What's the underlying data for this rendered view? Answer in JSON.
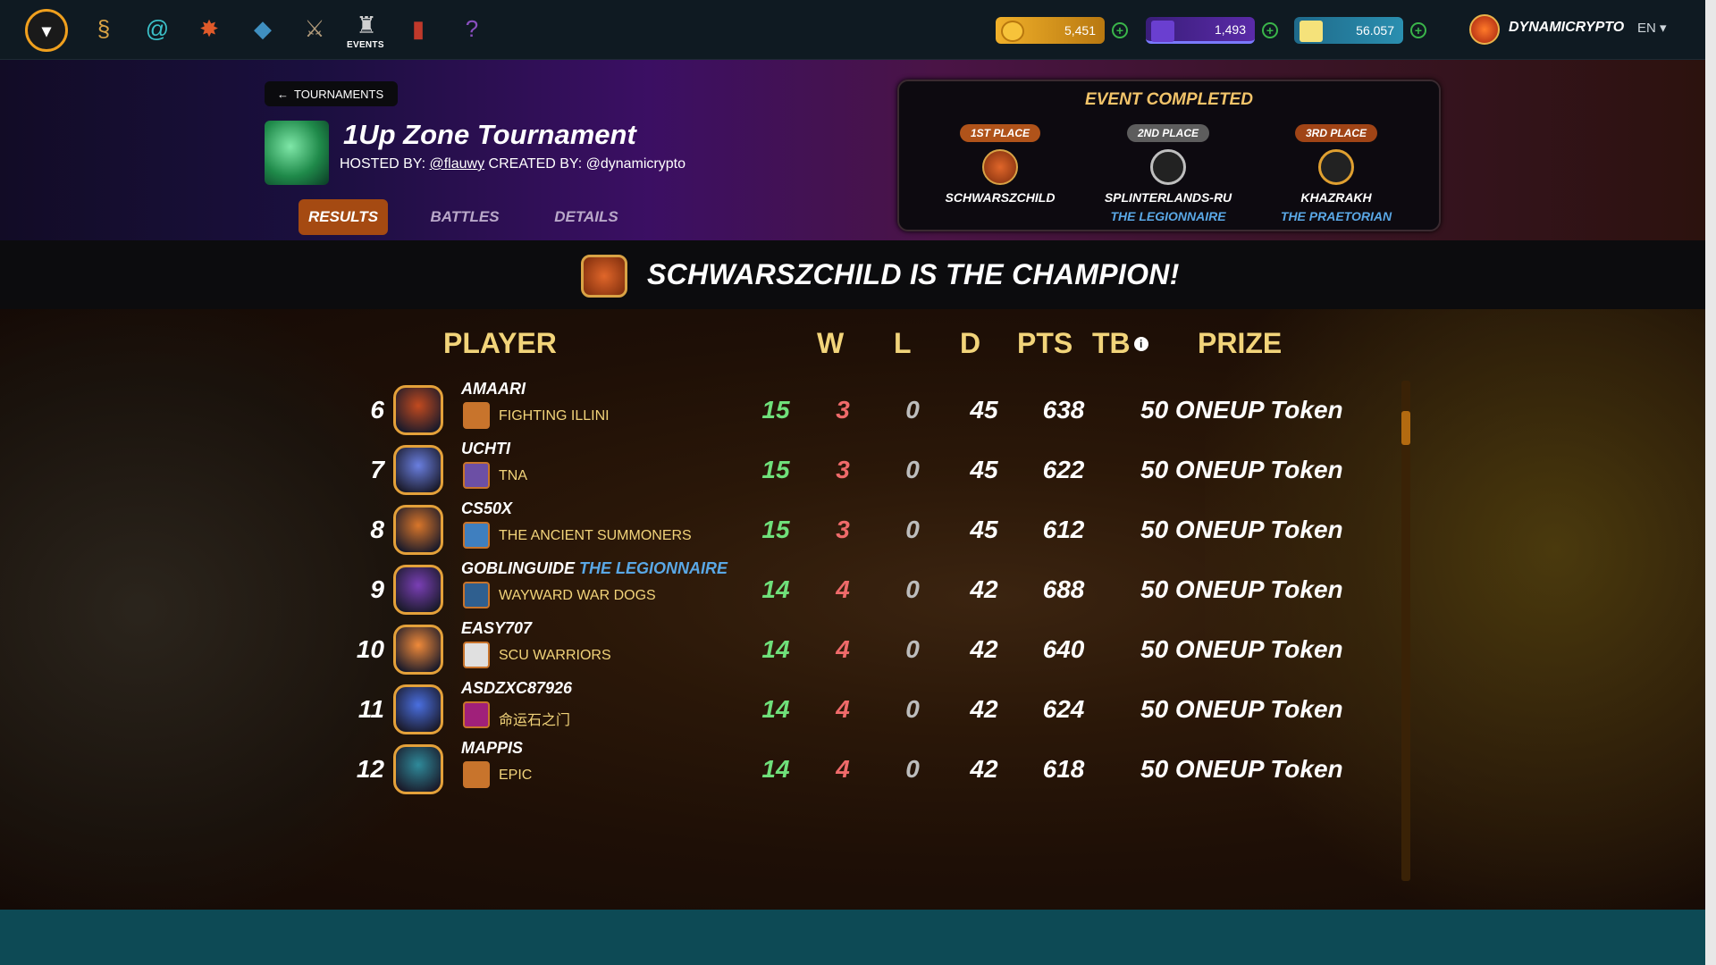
{
  "nav": {
    "icons": [
      "monster-logo-icon",
      "scroll-icon",
      "swirl-icon",
      "splinter-icon",
      "cards-icon",
      "sword-icon",
      "events-icon",
      "banner-icon",
      "quest-icon"
    ],
    "events_label": "EVENTS",
    "resources": [
      {
        "name": "credits",
        "value": "5,451",
        "color": "#e8a321"
      },
      {
        "name": "rank",
        "value": "1,493",
        "color": "#4b2a94"
      },
      {
        "name": "sps",
        "value": "56.057",
        "color": "#2a7fa0"
      }
    ],
    "username": "DYNAMICRYPTO",
    "language": "EN ▾"
  },
  "header": {
    "back_label": "TOURNAMENTS",
    "title": "1Up Zone Tournament",
    "hosted_prefix": "HOSTED BY:",
    "hosted_by": "@flauwy",
    "created_prefix": "CREATED BY:",
    "created_by": "@dynamicrypto",
    "tabs": {
      "results": "RESULTS",
      "battles": "BATTLES",
      "details": "DETAILS"
    }
  },
  "event": {
    "title": "EVENT COMPLETED",
    "places": [
      {
        "label": "1ST PLACE",
        "name": "SCHWARSZCHILD",
        "guild": "",
        "pill_color": "#b0531a"
      },
      {
        "label": "2ND PLACE",
        "name": "SPLINTERLANDS-RU",
        "guild": "THE LEGIONNAIRE",
        "pill_color": "#5d5d5d"
      },
      {
        "label": "3RD PLACE",
        "name": "KHAZRAKH",
        "guild": "THE PRAETORIAN",
        "pill_color": "#a04416"
      }
    ]
  },
  "champion": {
    "text": "SCHWARSZCHILD IS THE CHAMPION!"
  },
  "table": {
    "headers": {
      "player": "PLAYER",
      "w": "W",
      "l": "L",
      "d": "D",
      "pts": "PTS",
      "tb": "TB",
      "prize": "PRIZE"
    },
    "rows": [
      {
        "rank": "6",
        "name": "AMAARI",
        "name_guild": "",
        "guild": "FIGHTING ILLINI",
        "w": "15",
        "l": "3",
        "d": "0",
        "pts": "45",
        "tb": "638",
        "prize": "50 ONEUP Token",
        "avatar": "#c24a1f",
        "guild_color": "#c8742c"
      },
      {
        "rank": "7",
        "name": "UCHTI",
        "name_guild": "",
        "guild": "TNA",
        "w": "15",
        "l": "3",
        "d": "0",
        "pts": "45",
        "tb": "622",
        "prize": "50 ONEUP Token",
        "avatar": "#6a7fe0",
        "guild_color": "#6c4fa5"
      },
      {
        "rank": "8",
        "name": "CS50X",
        "name_guild": "",
        "guild": "THE ANCIENT SUMMONERS",
        "w": "15",
        "l": "3",
        "d": "0",
        "pts": "45",
        "tb": "612",
        "prize": "50 ONEUP Token",
        "avatar": "#d9762a",
        "guild_color": "#3f7fbf"
      },
      {
        "rank": "9",
        "name": "GOBLINGUIDE",
        "name_guild": "THE LEGIONNAIRE",
        "guild": "WAYWARD WAR DOGS",
        "w": "14",
        "l": "4",
        "d": "0",
        "pts": "42",
        "tb": "688",
        "prize": "50 ONEUP Token",
        "avatar": "#7a3fb5",
        "guild_color": "#2f5f8f"
      },
      {
        "rank": "10",
        "name": "EASY707",
        "name_guild": "",
        "guild": "SCU WARRIORS",
        "w": "14",
        "l": "4",
        "d": "0",
        "pts": "42",
        "tb": "640",
        "prize": "50 ONEUP Token",
        "avatar": "#f08a3a",
        "guild_color": "#e0e0e0"
      },
      {
        "rank": "11",
        "name": "ASDZXC87926",
        "name_guild": "",
        "guild": "命运石之门",
        "w": "14",
        "l": "4",
        "d": "0",
        "pts": "42",
        "tb": "624",
        "prize": "50 ONEUP Token",
        "avatar": "#4a6fe0",
        "guild_color": "#a0207a"
      },
      {
        "rank": "12",
        "name": "MAPPIS",
        "name_guild": "",
        "guild": "EPIC",
        "w": "14",
        "l": "4",
        "d": "0",
        "pts": "42",
        "tb": "618",
        "prize": "50 ONEUP Token",
        "avatar": "#2f8a9a",
        "guild_color": "#c8742c"
      }
    ]
  }
}
